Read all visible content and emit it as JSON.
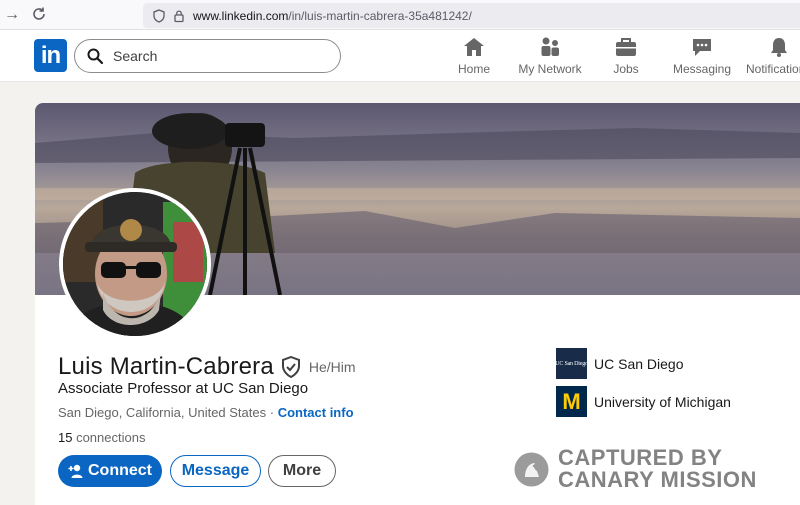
{
  "browser": {
    "url_domain": "www.linkedin.com",
    "url_path": "/in/luis-martin-cabrera-35a481242/"
  },
  "header": {
    "logo_text": "in",
    "search_placeholder": "Search",
    "nav": [
      {
        "label": "Home",
        "icon": "home-icon"
      },
      {
        "label": "My Network",
        "icon": "network-icon"
      },
      {
        "label": "Jobs",
        "icon": "briefcase-icon"
      },
      {
        "label": "Messaging",
        "icon": "chat-icon"
      },
      {
        "label": "Notifications",
        "icon": "bell-icon"
      }
    ]
  },
  "profile": {
    "name": "Luis Martin-Cabrera",
    "pronouns": "He/Him",
    "headline": "Associate Professor at UC San Diego",
    "location": "San Diego, California, United States",
    "separator": " · ",
    "contact_info_label": "Contact info",
    "connections_count": "15",
    "connections_label": " connections"
  },
  "actions": {
    "connect_label": "Connect",
    "message_label": "Message",
    "more_label": "More"
  },
  "education": [
    {
      "name": "UC San Diego",
      "logo_text": "UC San Diego",
      "logo_color": "#182b49"
    },
    {
      "name": "University of Michigan",
      "logo_text": "M",
      "logo_color": "#00274c",
      "accent": "#ffcb05"
    }
  ],
  "watermark": {
    "line1": "CAPTURED BY",
    "line2": "CANARY MISSION"
  },
  "colors": {
    "brand": "#0a66c2",
    "page_bg": "#f4f2ee"
  }
}
